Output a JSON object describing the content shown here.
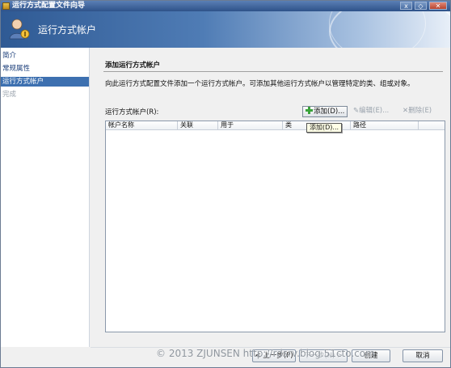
{
  "window": {
    "title": "运行方式配置文件向导",
    "controls": {
      "minimize": "x",
      "maximize": "◇",
      "close": "✕"
    }
  },
  "header": {
    "title": "运行方式帐户",
    "icon": "user-icon"
  },
  "sidebar": {
    "items": [
      {
        "label": "简介",
        "state": "normal"
      },
      {
        "label": "常规属性",
        "state": "normal"
      },
      {
        "label": "运行方式帐户",
        "state": "active"
      },
      {
        "label": "完成",
        "state": "inactive"
      }
    ]
  },
  "main": {
    "section_title": "添加运行方式帐户",
    "description": "向此运行方式配置文件添加一个运行方式帐户。可添加其他运行方式帐户以管理特定的类、组或对象。",
    "accounts_label": "运行方式帐户(R):",
    "toolbar": {
      "add": "添加(D)...",
      "edit": "编辑(E)...",
      "delete": "删除(E)"
    },
    "columns": [
      "帐户名称",
      "关联",
      "用于",
      "类",
      "路径"
    ],
    "rows": [],
    "tooltip": "添加(D)..."
  },
  "footer": {
    "buttons": {
      "previous": "< 上一步(P)",
      "next": "下一步(N) >",
      "create": "创建",
      "cancel": "取消"
    },
    "watermark": "© 2013 ZJUNSEN http://rdsrv.blog.51cto.com"
  },
  "colors": {
    "accent": "#3d70b0",
    "header_start": "#2f5a94",
    "titlebar": "#2e5289"
  }
}
